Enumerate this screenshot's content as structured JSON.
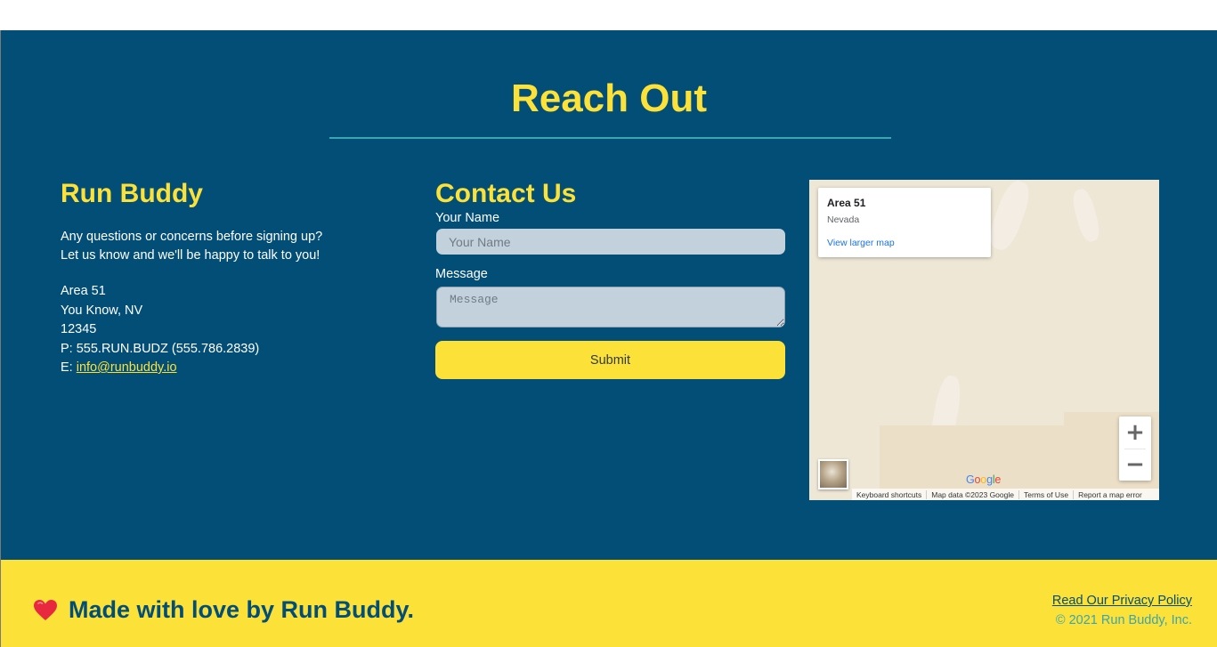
{
  "contact_section": {
    "title": "Reach Out"
  },
  "info": {
    "heading": "Run Buddy",
    "intro_line_1": "Any questions or concerns before signing up?",
    "intro_line_2": "Let us know and we'll be happy to talk to you!",
    "address": {
      "line_1": "Area 51",
      "line_2": "You Know, NV",
      "line_3": "12345",
      "phone": "P: 555.RUN.BUDZ (555.786.2839)",
      "email_prefix": "E: ",
      "email": "info@runbuddy.io"
    }
  },
  "form": {
    "heading": "Contact Us",
    "name_label": "Your Name",
    "name_placeholder": "Your Name",
    "message_label": "Message",
    "message_placeholder": "Message",
    "submit_label": "Submit"
  },
  "map": {
    "place_name": "Area 51",
    "place_region": "Nevada",
    "larger_map_link": "View larger map",
    "zoom_in_icon": "plus-icon",
    "zoom_out_icon": "minus-icon",
    "logo": "Google",
    "attribution": {
      "shortcuts": "Keyboard shortcuts",
      "map_data": "Map data ©2023 Google",
      "terms": "Terms of Use",
      "report": "Report a map error"
    }
  },
  "footer": {
    "heart_icon": "heart-icon",
    "tagline": "Made with love by Run Buddy.",
    "privacy_link": "Read Our Privacy Policy",
    "copyright": "© 2021 Run Buddy, Inc."
  },
  "colors": {
    "primary_blue": "#024e76",
    "accent_yellow": "#fce138",
    "teal": "#39a6b2",
    "input_bg": "#c3d1dc"
  }
}
